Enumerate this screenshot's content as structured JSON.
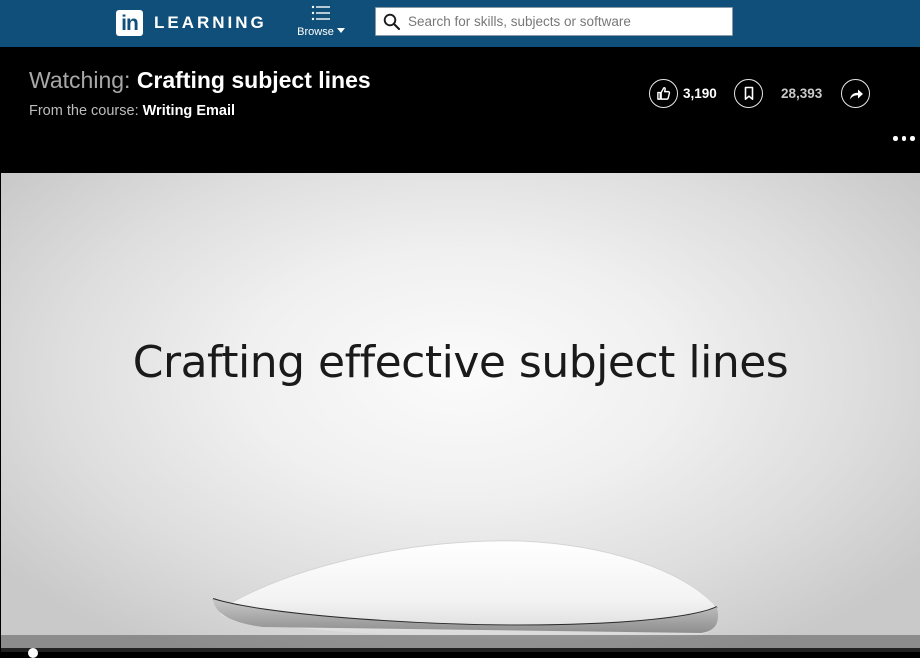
{
  "brand": {
    "logo_text": "in",
    "word": "LEARNING"
  },
  "nav": {
    "browse_label": "Browse"
  },
  "search": {
    "placeholder": "Search for skills, subjects or software",
    "value": ""
  },
  "video": {
    "watching_prefix": "Watching:",
    "title": "Crafting subject lines",
    "course_prefix": "From the course:",
    "course_name": "Writing Email",
    "likes": "3,190",
    "saves": "28,393",
    "slide_text": "Crafting effective subject lines",
    "progress_fraction": 0.02
  },
  "colors": {
    "topbar": "#0f4f79",
    "header_bg": "#000000",
    "accent_text": "#ffffff"
  },
  "icons": [
    "search-icon",
    "browse-list-icon",
    "thumbs-up-icon",
    "bookmark-icon",
    "share-icon",
    "more-icon"
  ]
}
